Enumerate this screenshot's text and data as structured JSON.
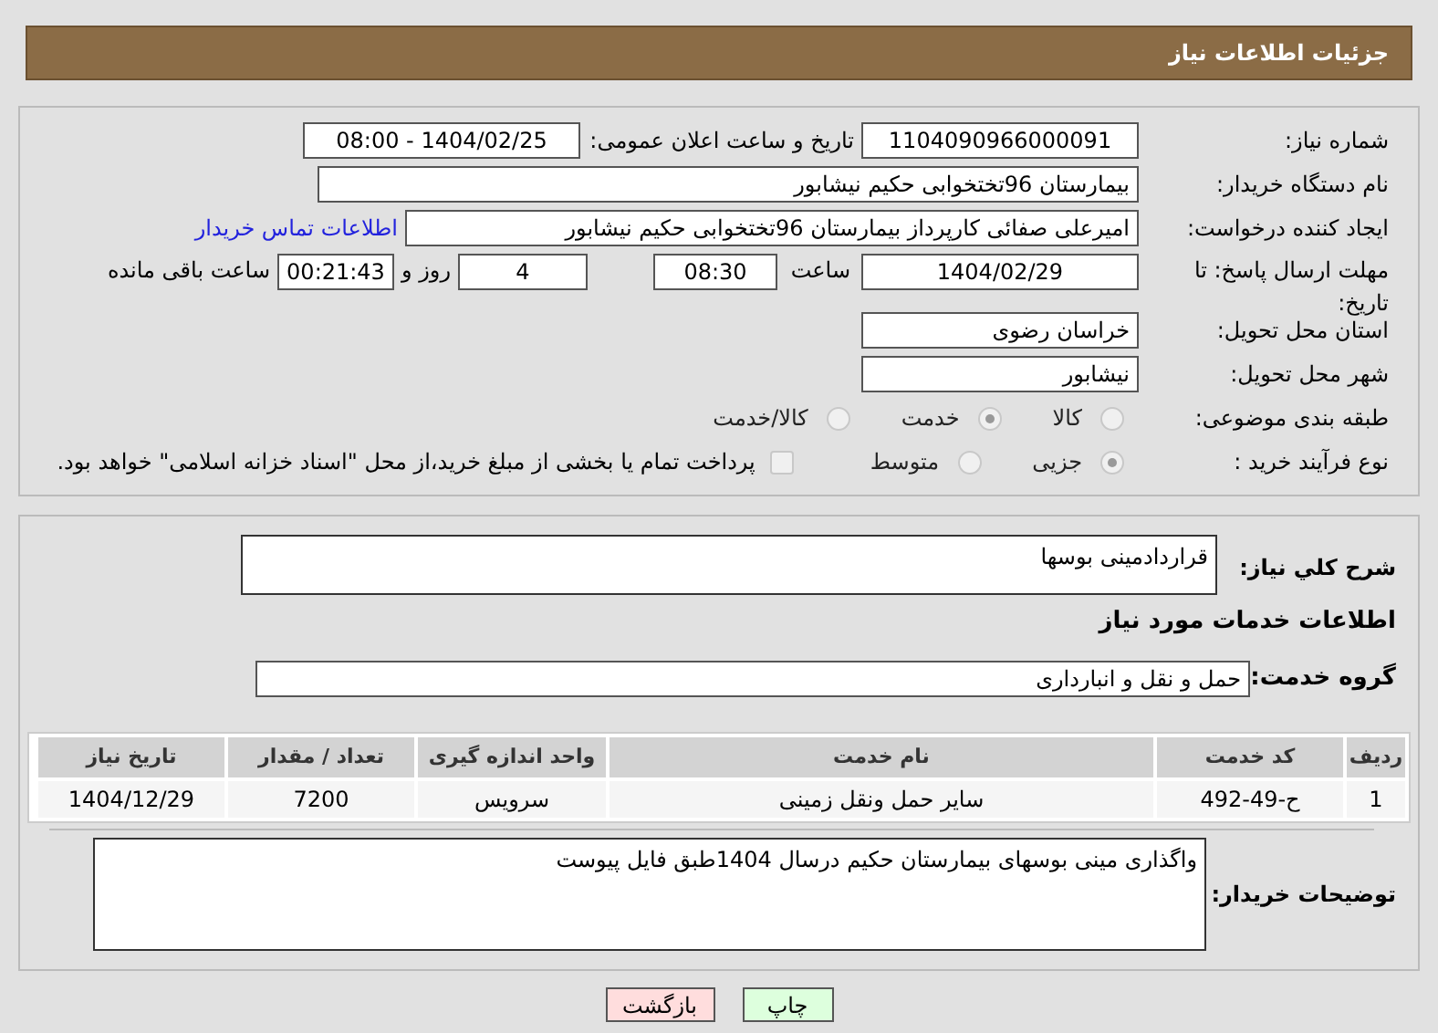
{
  "header": {
    "title": "جزئیات اطلاعات نیاز"
  },
  "need_number": {
    "label": "شماره نیاز:",
    "value": "1104090966000091"
  },
  "announce": {
    "label": "تاریخ و ساعت اعلان عمومی:",
    "value": "1404/02/25 - 08:00"
  },
  "buyer_org": {
    "label": "نام دستگاه خریدار:",
    "value": "بیمارستان 96تختخوابی حکیم نیشابور"
  },
  "requester": {
    "label": "ایجاد کننده درخواست:",
    "value": "امیرعلی صفائی کارپرداز بیمارستان 96تختخوابی حکیم نیشابور",
    "link": "اطلاعات تماس خریدار"
  },
  "deadline": {
    "label": "مهلت ارسال پاسخ: تا تاریخ:",
    "date": "1404/02/29",
    "time_label": "ساعت",
    "time": "08:30",
    "days": "4",
    "days_label": "روز و",
    "remaining": "00:21:43",
    "remaining_label": "ساعت باقی مانده"
  },
  "province": {
    "label": "استان محل تحویل:",
    "value": "خراسان رضوی"
  },
  "city": {
    "label": "شهر محل تحویل:",
    "value": "نیشابور"
  },
  "category": {
    "label": "طبقه بندی موضوعی:",
    "options": [
      {
        "label": "کالا",
        "selected": false
      },
      {
        "label": "خدمت",
        "selected": true
      },
      {
        "label": "کالا/خدمت",
        "selected": false
      }
    ]
  },
  "purchase_type": {
    "label": "نوع فرآیند خرید :",
    "options": [
      {
        "label": "جزیی",
        "selected": true
      },
      {
        "label": "متوسط",
        "selected": false
      }
    ],
    "payment": {
      "label": "پرداخت تمام یا بخشی از مبلغ خرید،از محل \"اسناد خزانه اسلامی\" خواهد بود.",
      "checked": false
    }
  },
  "description": {
    "label": "شرح کلي نياز:",
    "value": "قراردادمینی بوسها"
  },
  "services_title": "اطلاعات خدمات مورد نیاز",
  "service_group": {
    "label": "گروه خدمت:",
    "value": "حمل و نقل و انبارداری"
  },
  "table": {
    "columns": [
      "ردیف",
      "کد خدمت",
      "نام خدمت",
      "واحد اندازه گیری",
      "تعداد / مقدار",
      "تاریخ نیاز"
    ],
    "rows": [
      [
        "1",
        "ح-49-492",
        "سایر حمل ونقل زمینی",
        "سرویس",
        "7200",
        "1404/12/29"
      ]
    ]
  },
  "buyer_notes": {
    "label": "توضیحات خریدار:",
    "value": "واگذاری مینی بوسهای بیمارستان حکیم درسال 1404طبق فایل پیوست"
  },
  "buttons": [
    {
      "label": "چاپ",
      "kind": "print"
    },
    {
      "label": "بازگشت",
      "kind": "back"
    }
  ]
}
